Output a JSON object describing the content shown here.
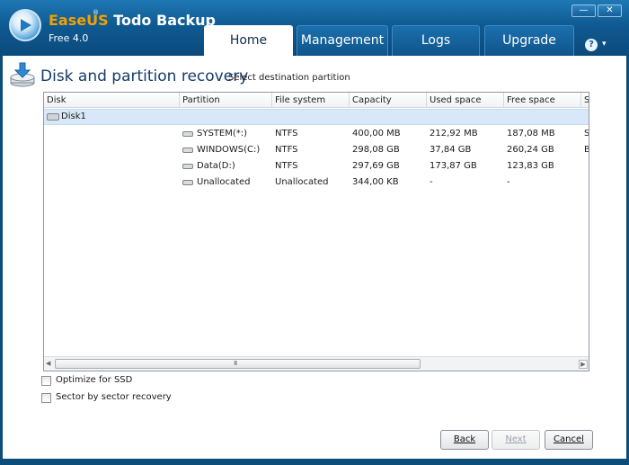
{
  "app": {
    "brand_part1": "EaseUS",
    "brand_part2": " Todo Backup",
    "registered_mark": "®",
    "edition": "Free 4.0",
    "accent_color": "#f4a000"
  },
  "window_controls": {
    "minimize": "—",
    "close": "✕"
  },
  "tabs": [
    {
      "label": "Home",
      "active": true
    },
    {
      "label": "Management",
      "active": false
    },
    {
      "label": "Logs",
      "active": false
    },
    {
      "label": "Upgrade",
      "active": false
    }
  ],
  "help": {
    "icon": "?",
    "dropdown": "▾"
  },
  "page": {
    "title": "Disk and partition recovery",
    "subtitle": "Select destination partition"
  },
  "table": {
    "columns": [
      "Disk",
      "Partition",
      "File system",
      "Capacity",
      "Used space",
      "Free space",
      "S"
    ],
    "disk": "Disk1",
    "partitions": [
      {
        "name": "SYSTEM(*:)",
        "fs": "NTFS",
        "capacity": "400,00 MB",
        "used": "212,92 MB",
        "free": "187,08 MB",
        "status": "S"
      },
      {
        "name": "WINDOWS(C:)",
        "fs": "NTFS",
        "capacity": "298,08 GB",
        "used": "37,84 GB",
        "free": "260,24 GB",
        "status": "B"
      },
      {
        "name": "Data(D:)",
        "fs": "NTFS",
        "capacity": "297,69 GB",
        "used": "173,87 GB",
        "free": "123,83 GB",
        "status": ""
      },
      {
        "name": "Unallocated",
        "fs": "Unallocated",
        "capacity": "344,00 KB",
        "used": "-",
        "free": "-",
        "status": ""
      }
    ]
  },
  "scrollbar": {
    "left_arrow": "◀",
    "right_arrow": "▶",
    "grip": "III"
  },
  "options": {
    "optimize_ssd": {
      "label": "Optimize for SSD",
      "checked": false
    },
    "sector_recovery": {
      "label": "Sector by sector recovery",
      "checked": false
    }
  },
  "buttons": {
    "back": "Back",
    "next": "Next",
    "cancel": "Cancel"
  }
}
